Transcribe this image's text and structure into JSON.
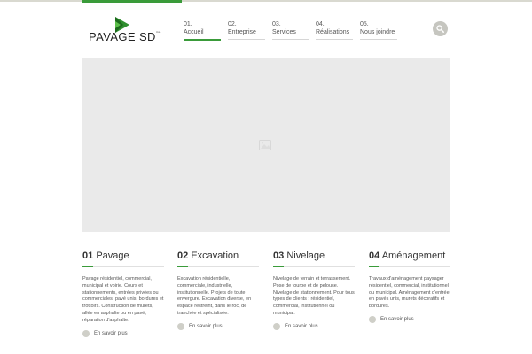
{
  "logo": {
    "text": "PAVAGE SD",
    "tm": "inc.",
    "mark_color": "#2f8f2f"
  },
  "nav": [
    {
      "num": "01.",
      "label": "Accueil",
      "active": true
    },
    {
      "num": "02.",
      "label": "Entreprise"
    },
    {
      "num": "03.",
      "label": "Services"
    },
    {
      "num": "04.",
      "label": "Réalisations"
    },
    {
      "num": "05.",
      "label": "Nous joindre"
    }
  ],
  "search": {
    "icon": "search-icon"
  },
  "hero": {
    "icon": "image-placeholder-icon"
  },
  "services": [
    {
      "num": "01",
      "title": "Pavage",
      "text": "Pavage résidentiel, commercial, municipal et voirie. Cours et stationnements, entrées privées ou commerciales, pavé unis, bordures et trottoirs. Construction de murets, allée en asphalte ou en pavé, réparation d'asphalte.",
      "more": "En savoir plus"
    },
    {
      "num": "02",
      "title": "Excavation",
      "text": "Excavation résidentielle, commerciale, industrielle, institutionnelle. Projets de toute envergure. Excavation diverse, en espace restreint, dans le roc, de tranchée et spécialisée.",
      "more": "En savoir plus"
    },
    {
      "num": "03",
      "title": "Nivelage",
      "text": "Nivelage de terrain et terrassement. Pose de tourbe et de pelouse. Nivelage de stationnement. Pour tous types de clients : résidentiel, commercial, institutionnel ou municipal.",
      "more": "En savoir plus"
    },
    {
      "num": "04",
      "title": "Aménagement",
      "text": "Travaux d'aménagement paysager résidentiel, commercial, institutionnel ou municipal. Aménagement d'entrée en pavés unis, murets décoratifs et bordures.",
      "more": "En savoir plus"
    }
  ],
  "colors": {
    "accent": "#3a9b3a",
    "hero_bg": "#eaeaea",
    "button_grey": "#c6c6c0"
  }
}
